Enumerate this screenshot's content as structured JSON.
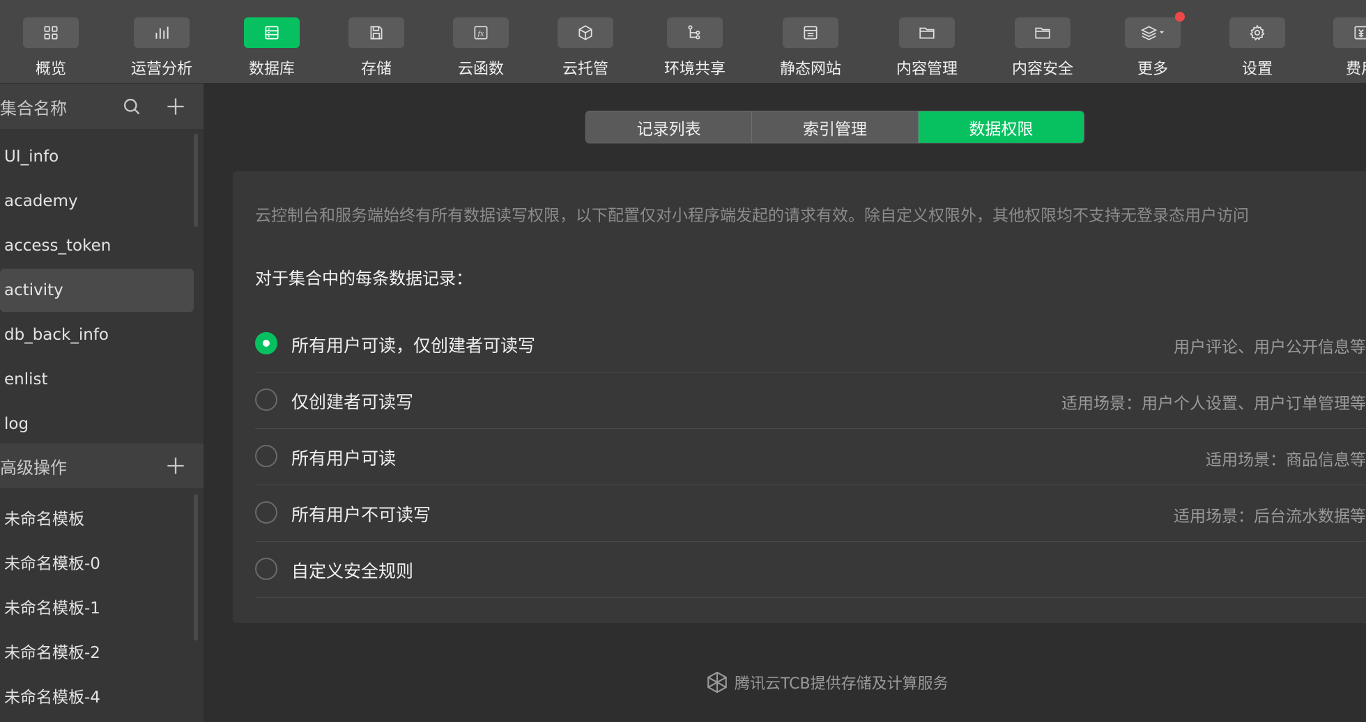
{
  "toolbar": {
    "items": [
      {
        "label": "概览",
        "icon": "overview-icon"
      },
      {
        "label": "运营分析",
        "icon": "analytics-icon"
      },
      {
        "label": "数据库",
        "icon": "database-icon",
        "active": true
      },
      {
        "label": "存储",
        "icon": "storage-icon"
      },
      {
        "label": "云函数",
        "icon": "function-icon"
      },
      {
        "label": "云托管",
        "icon": "cloud-hosting-icon"
      },
      {
        "label": "环境共享",
        "icon": "env-share-icon"
      },
      {
        "label": "静态网站",
        "icon": "static-site-icon"
      },
      {
        "label": "内容管理",
        "icon": "content-manage-icon"
      },
      {
        "label": "内容安全",
        "icon": "content-security-icon"
      },
      {
        "label": "更多",
        "icon": "layers-icon",
        "badge": true
      },
      {
        "label": "设置",
        "icon": "gear-icon"
      },
      {
        "label": "费用",
        "icon": "cost-icon"
      }
    ],
    "accent": "#07c160"
  },
  "sidebar": {
    "collections_title": "集合名称",
    "collections": [
      "UI_info",
      "academy",
      "access_token",
      "activity",
      "db_back_info",
      "enlist",
      "log"
    ],
    "selected": "activity",
    "advanced_title": "高级操作",
    "templates": [
      "未命名模板",
      "未命名模板-0",
      "未命名模板-1",
      "未命名模板-2",
      "未命名模板-4"
    ]
  },
  "tabs": [
    "记录列表",
    "索引管理",
    "数据权限"
  ],
  "active_tab": "数据权限",
  "permission": {
    "notice": "云控制台和服务端始终有所有数据读写权限，以下配置仅对小程序端发起的请求有效。除自定义权限外，其他权限均不支持无登录态用户访问",
    "subtitle": "对于集合中的每条数据记录：",
    "options": [
      {
        "label": "所有用户可读，仅创建者可读写",
        "scene": "用户评论、用户公开信息等",
        "selected": true
      },
      {
        "label": "仅创建者可读写",
        "scene": "适用场景：用户个人设置、用户订单管理等"
      },
      {
        "label": "所有用户可读",
        "scene": "适用场景：商品信息等"
      },
      {
        "label": "所有用户不可读写",
        "scene": "适用场景：后台流水数据等"
      },
      {
        "label": "自定义安全规则",
        "scene": ""
      }
    ]
  },
  "footer": {
    "text": "腾讯云TCB提供存储及计算服务"
  }
}
